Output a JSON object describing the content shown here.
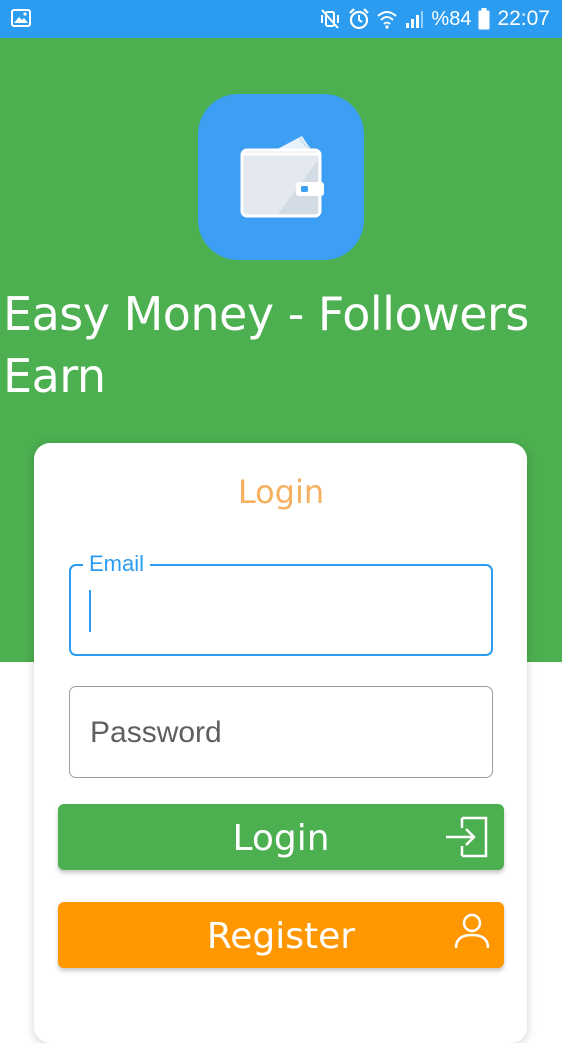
{
  "status_bar": {
    "battery_percent": "%84",
    "time": "22:07",
    "icons": [
      "gallery-icon",
      "mute-vibrate-icon",
      "alarm-icon",
      "wifi-icon",
      "signal-icon",
      "battery-icon"
    ]
  },
  "app": {
    "title": "Easy Money - Followers Earn",
    "icon": "wallet-icon"
  },
  "login_card": {
    "title": "Login",
    "email_field": {
      "label": "Email",
      "value": ""
    },
    "password_field": {
      "placeholder": "Password",
      "value": ""
    },
    "login_button": {
      "label": "Login",
      "icon": "sign-in-icon"
    },
    "register_button": {
      "label": "Register",
      "icon": "person-icon"
    }
  },
  "colors": {
    "status_bar": "#2b9cf0",
    "header_green": "#4caf50",
    "app_icon_bg": "#3d9ff4",
    "card_title": "#f5b060",
    "focus_blue": "#2b9cf0",
    "login_button": "#4caf50",
    "register_button": "#ff9800"
  }
}
